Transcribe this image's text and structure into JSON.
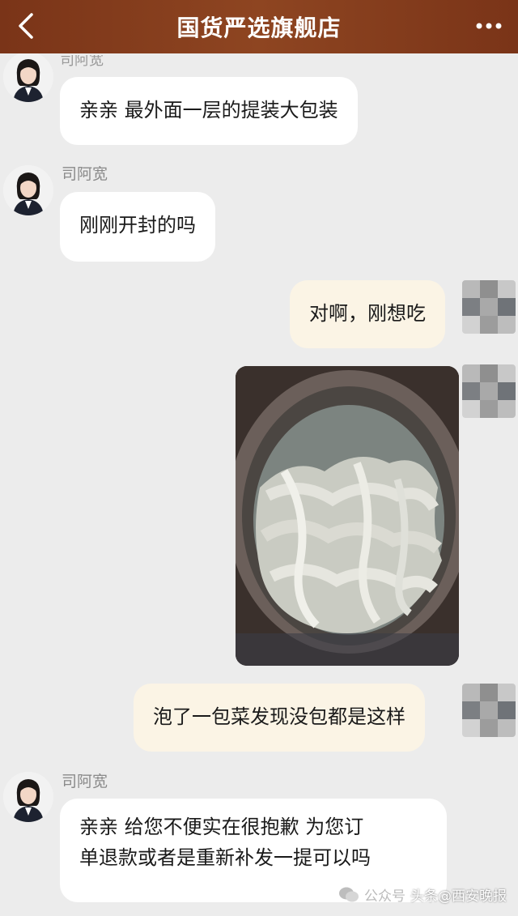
{
  "header": {
    "title": "国货严选旗舰店",
    "back_icon": "chevron-left-icon",
    "more_icon": "more-dots-icon",
    "color": "#7f3a1b"
  },
  "messages": [
    {
      "from": "agent",
      "sender": "司阿宽",
      "text": "亲亲  最外面一层的提装大包装"
    },
    {
      "from": "agent",
      "sender": "司阿宽",
      "text": "刚刚开封的吗"
    },
    {
      "from": "me",
      "text": "对啊，刚想吃"
    },
    {
      "from": "me",
      "type": "image",
      "description": "noodles-photo"
    },
    {
      "from": "me",
      "text": "泡了一包菜发现没包都是这样"
    },
    {
      "from": "agent",
      "sender": "司阿宽",
      "text": "亲亲  给您不便实在很抱歉  为您订\n单退款或者是重新补发一提可以吗"
    }
  ],
  "watermark": {
    "wechat": "公众号",
    "text": "头条@西安晚报"
  },
  "colors": {
    "background": "#ececec",
    "agent_bubble": "#ffffff",
    "my_bubble": "#fbf4e5"
  }
}
